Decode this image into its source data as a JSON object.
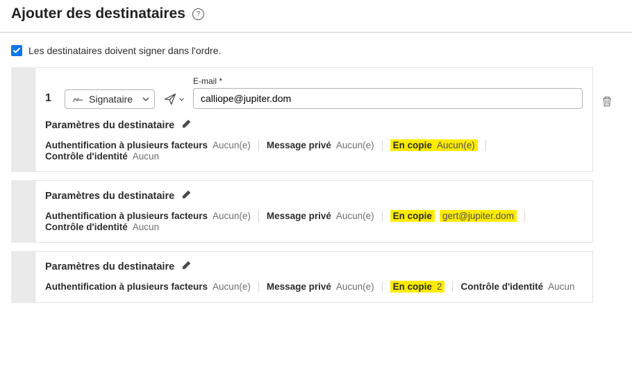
{
  "header": {
    "title": "Ajouter des destinataires"
  },
  "order": {
    "label": "Les destinataires doivent signer dans l'ordre."
  },
  "recipients": [
    {
      "number": "1",
      "role": "Signataire",
      "email_label": "E-mail",
      "required_mark": "*",
      "email_value": "calliope@jupiter.dom",
      "settings_title": "Paramètres du destinataire",
      "mfa_label": "Authentification à plusieurs facteurs",
      "mfa_value": "Aucun(e)",
      "msg_label": "Message privé",
      "msg_value": "Aucun(e)",
      "cc_label": "En copie",
      "cc_value": "Aucun(e)",
      "id_label": "Contrôle d'identité",
      "id_value": "Aucun"
    },
    {
      "settings_title": "Paramètres du destinataire",
      "mfa_label": "Authentification à plusieurs facteurs",
      "mfa_value": "Aucun(e)",
      "msg_label": "Message privé",
      "msg_value": "Aucun(e)",
      "cc_label": "En copie",
      "cc_value": "gert@jupiter.dom",
      "id_label": "Contrôle d'identité",
      "id_value": "Aucun"
    },
    {
      "settings_title": "Paramètres du destinataire",
      "mfa_label": "Authentification à plusieurs facteurs",
      "mfa_value": "Aucun(e)",
      "msg_label": "Message privé",
      "msg_value": "Aucun(e)",
      "cc_label": "En copie",
      "cc_value": "2",
      "id_label": "Contrôle d'identité",
      "id_value": "Aucun"
    }
  ]
}
